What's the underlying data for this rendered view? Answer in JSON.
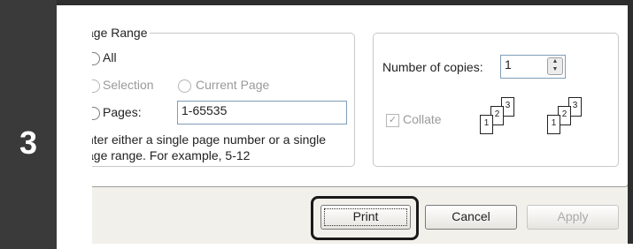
{
  "step": {
    "number": "3"
  },
  "page_range": {
    "legend": "age Range",
    "all_label": "All",
    "selection_label": "Selection",
    "current_page_label": "Current Page",
    "pages_label": "Pages:",
    "pages_value": "1-65535",
    "hint_line1": "nter either a single page number or a single",
    "hint_line2": "age range.  For example, 5-12"
  },
  "copies": {
    "label": "Number of copies:",
    "value": "1",
    "collate_label": "Collate",
    "collate_checked": true,
    "collate_glyph": "✓",
    "spin_up_glyph": "▲",
    "spin_down_glyph": "▼"
  },
  "collate_illustration": {
    "set_a": [
      "1",
      "2",
      "3"
    ],
    "set_b": [
      "1",
      "2",
      "3"
    ]
  },
  "buttons": {
    "print_label": "Print",
    "cancel_label": "Cancel",
    "apply_label": "Apply"
  }
}
